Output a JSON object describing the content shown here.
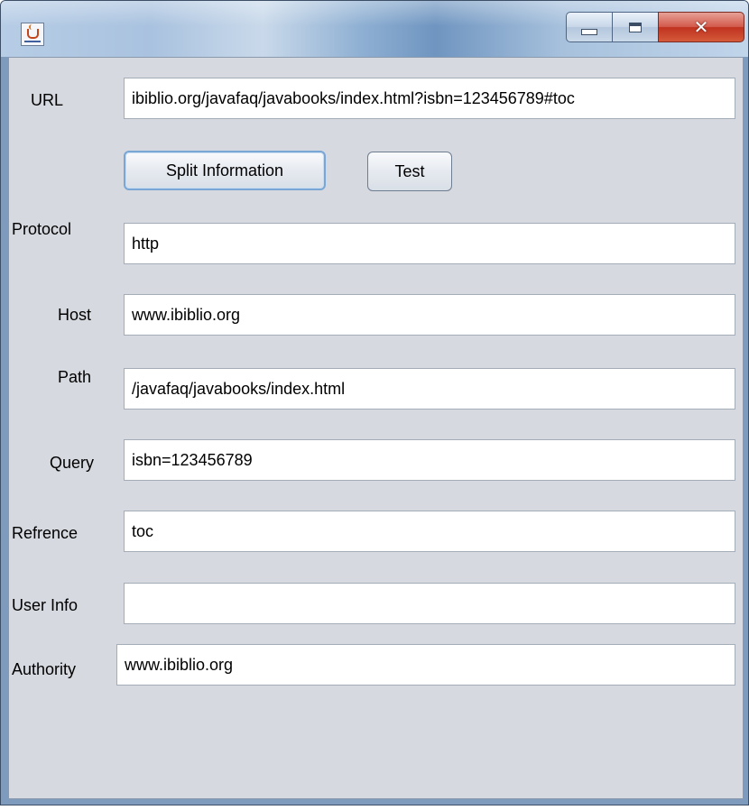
{
  "window": {
    "title": ""
  },
  "url": {
    "label": "URL",
    "value": "ibiblio.org/javafaq/javabooks/index.html?isbn=123456789#toc"
  },
  "buttons": {
    "split": "Split Information",
    "test": "Test"
  },
  "fields": {
    "protocol": {
      "label": "Protocol",
      "value": "http"
    },
    "host": {
      "label": "Host",
      "value": "www.ibiblio.org"
    },
    "path": {
      "label": "Path",
      "value": "/javafaq/javabooks/index.html"
    },
    "query": {
      "label": "Query",
      "value": "isbn=123456789"
    },
    "reference": {
      "label": "Refrence",
      "value": "toc"
    },
    "userinfo": {
      "label": "User Info",
      "value": ""
    },
    "authority": {
      "label": "Authority",
      "value": "www.ibiblio.org"
    }
  },
  "icons": {
    "app": "java-cup-icon",
    "minimize": "minimize-icon",
    "maximize": "maximize-icon",
    "close": "close-icon"
  },
  "colors": {
    "panel_background": "#d6d9df",
    "close_button": "#c0321f",
    "focus_border": "#7aa6d6"
  }
}
